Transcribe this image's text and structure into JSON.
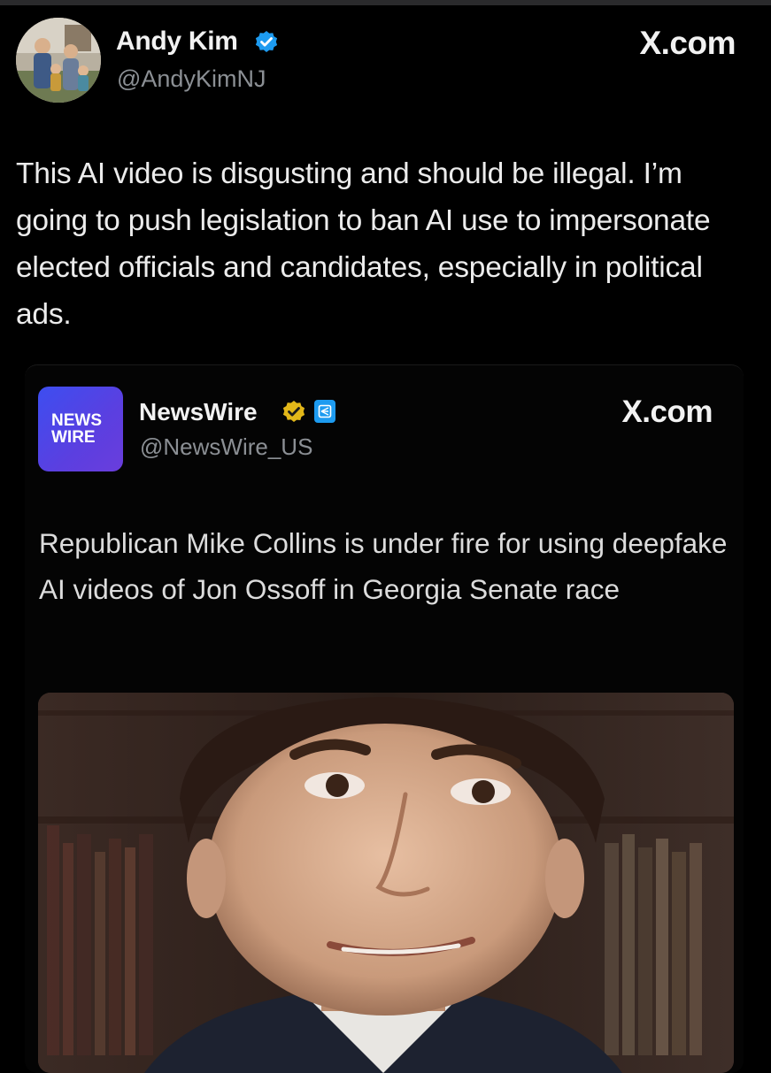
{
  "tweet": {
    "author_name": "Andy Kim",
    "author_handle": "@AndyKimNJ",
    "source_label": "X.com",
    "text": "This AI video is disgusting and should be illegal. I’m going to push legislation to ban AI use to impersonate elected officials and candidates, especially in political ads.",
    "verified_color": "#1d9bf0"
  },
  "quoted_tweet": {
    "logo_line1": "NEWS",
    "logo_line2": "WIRE",
    "author_name": "NewsWire",
    "author_handle": "@NewsWire_US",
    "source_label": "X.com",
    "text": "Republican Mike Collins is under fire for using deepfake AI videos of Jon Ossoff in Georgia Senate race",
    "verified_color": "#e2b719",
    "affiliate_badge_color": "#1d9bf0"
  },
  "icons": {
    "verified": "verified-badge-icon",
    "gold_verified": "gold-verified-badge-icon",
    "affiliate": "affiliate-badge-icon"
  }
}
